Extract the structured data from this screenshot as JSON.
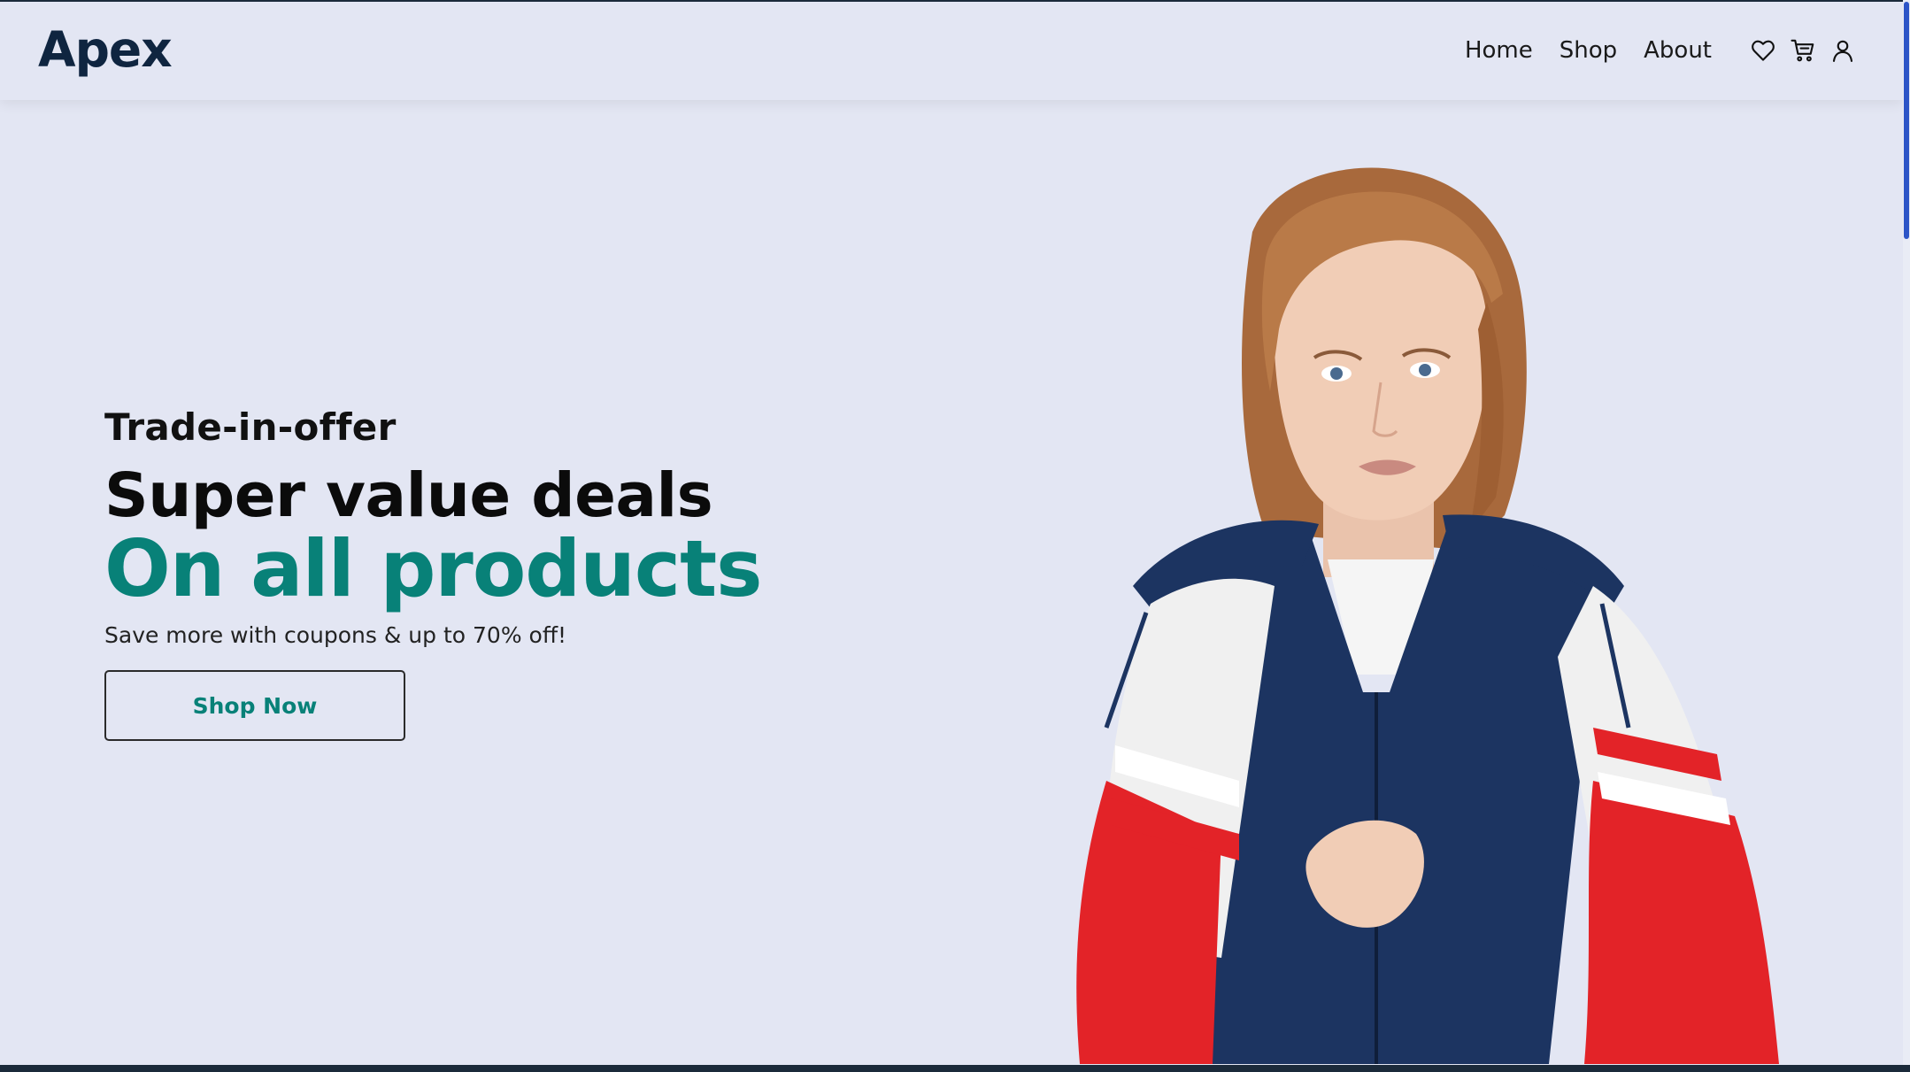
{
  "brand": {
    "logo_text": "Apex",
    "accent_color": "#088178",
    "dark_color": "#0F2540"
  },
  "nav": {
    "links": [
      "Home",
      "Shop",
      "About"
    ],
    "icons": [
      "heart-icon",
      "cart-icon",
      "user-icon"
    ]
  },
  "hero": {
    "eyebrow": "Trade-in-offer",
    "headline": "Super value deals",
    "headline_accent": "On all products",
    "subtext": "Save more with coupons & up to 70% off!",
    "cta_label": "Shop Now",
    "background_color": "#E3E6F3"
  }
}
